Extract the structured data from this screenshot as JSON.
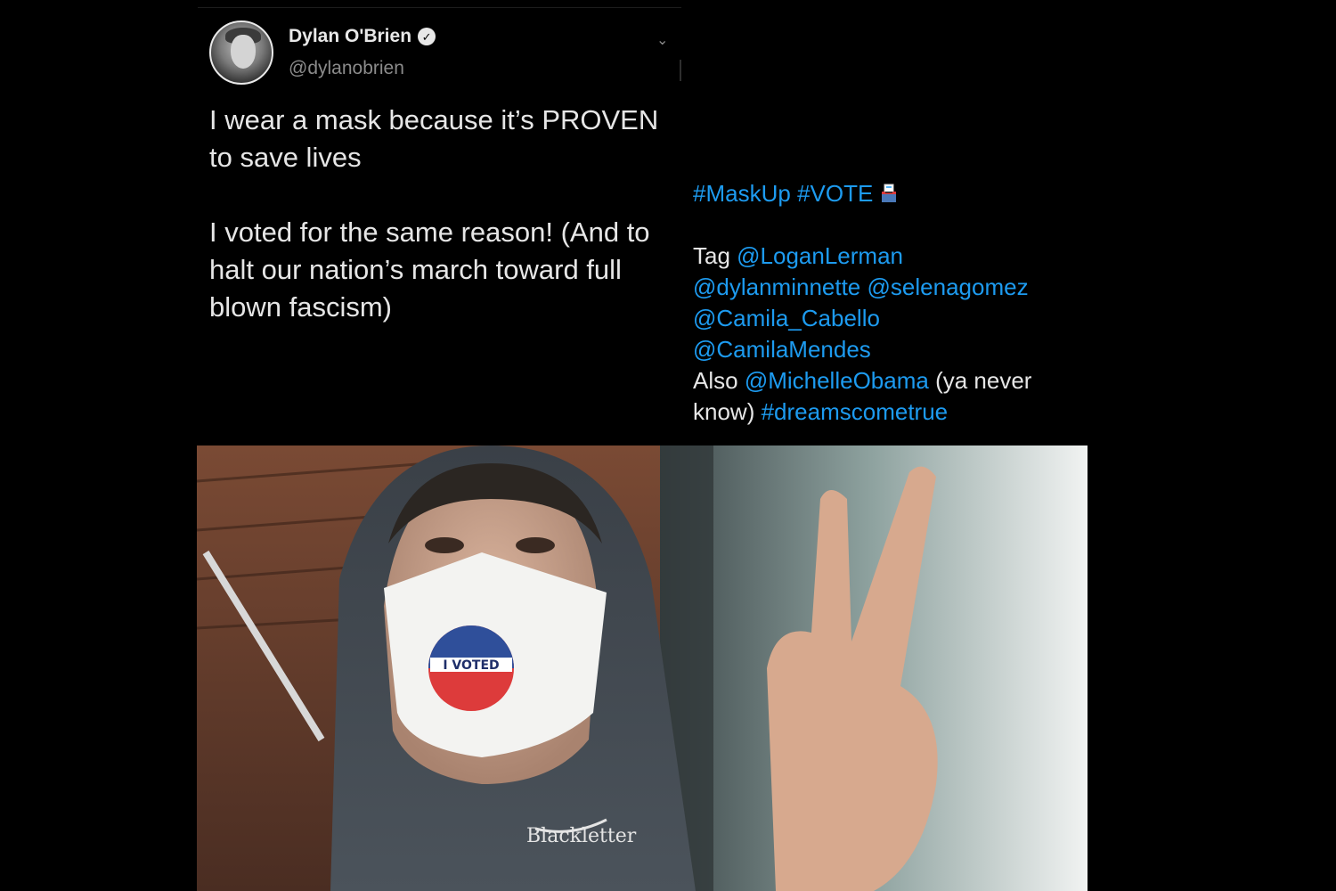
{
  "tweet": {
    "display_name": "Dylan O'Brien",
    "handle": "@dylanobrien",
    "paragraph_1": "I wear a mask because it’s PROVEN to save lives",
    "paragraph_2": "I voted for the same reason! (And to halt our nation’s march toward full blown fascism)"
  },
  "tweet_continued": {
    "hashtag_maskup": "#MaskUp",
    "hashtag_vote": "#VOTE",
    "tag_label": "Tag",
    "mention_logan": "@LoganLerman",
    "mention_dylanminnette": "@dylanminnette",
    "mention_selena": "@selenagomez",
    "mention_camila_cabello": "@Camila_Cabello",
    "mention_camila_mendes": "@CamilaMendes",
    "also_label": "Also",
    "mention_michelle": "@MichelleObama",
    "ya_never_know": "(ya never know)",
    "hashtag_dreams": "#dreamscometrue"
  },
  "photo": {
    "sticker_text": "I VOTED",
    "hoodie_text": "Blackletter"
  },
  "icons": {
    "verified": "verified-badge-icon",
    "chevron": "chevron-down-icon",
    "ballot": "ballot-box-icon"
  },
  "colors": {
    "background": "#000000",
    "text": "#e6e6e6",
    "link": "#1d9bf0",
    "muted": "#8b8b8b"
  }
}
